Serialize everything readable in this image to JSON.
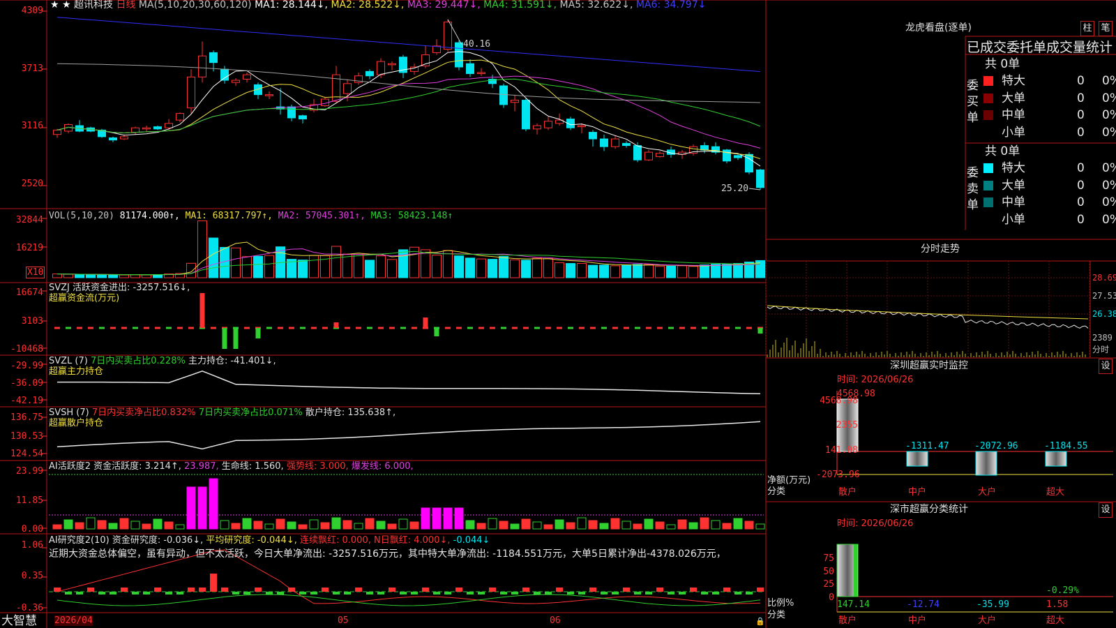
{
  "colors": {
    "up": "#ff3232",
    "down": "#00e5f0",
    "border": "#b81414",
    "ma1": "#ffffff",
    "ma2": "#f0e040",
    "ma3": "#e040e0",
    "ma4": "#30d030",
    "ma5": "#a0a0a0",
    "ma6": "#3030ff"
  },
  "main": {
    "star": "★ ★",
    "stock_name": "超讯科技",
    "period": "日线",
    "ma_list": "MA(5,10,20,30,60,120)",
    "ma1": "MA1: 28.144↓,",
    "ma2": "MA2: 28.522↓,",
    "ma3": "MA3: 29.447↓,",
    "ma4": "MA4: 31.591↓,",
    "ma5": "MA5: 32.622↓,",
    "ma6": "MA6: 34.797↓",
    "y_labels": [
      "4309",
      "3713",
      "3116",
      "2520"
    ],
    "high_label": "40.16",
    "low_label": "25.20"
  },
  "vol": {
    "title": "VOL(5,10,20)",
    "value": "81174.000↑,",
    "ma1": "MA1: 68317.797↑,",
    "ma2": "MA2: 57045.301↑,",
    "ma3": "MA3: 58423.148↑",
    "y_labels": [
      "32844",
      "16219"
    ],
    "unit": "X10"
  },
  "svzj": {
    "title": "SVZJ  活跃资金进出: -3257.516↓,",
    "subtitle": "超赢资金流(万元)",
    "y_labels": [
      "16674",
      "3103",
      "-10468"
    ]
  },
  "svzl": {
    "title": "SVZL (7)",
    "p1": "7日内买卖占比0.228%",
    "p2": "主力持仓: -41.401↓,",
    "subtitle": "超赢主力持仓",
    "y_labels": [
      "-29.99",
      "-36.09",
      "-42.19"
    ]
  },
  "svsh": {
    "title": "SVSH (7)",
    "p1": "7日内买卖净占比0.832%",
    "p2": "7日内买卖净占比0.071%",
    "p3": "散户持仓: 135.638↑,",
    "subtitle": "超赢散户持仓",
    "y_labels": [
      "136.75",
      "130.53",
      "124.54"
    ]
  },
  "ai2": {
    "title": "AI活跃度2 资金活跃度: 3.214↑,",
    "v1": "23.987,",
    "v2": "生命线: 1.560,",
    "v3": "强势线: 3.000,",
    "v4": "爆发线: 6.000,",
    "y_labels": [
      "23.99",
      "11.85",
      "0.00"
    ]
  },
  "ai10": {
    "title": "AI研究度2(10) 资金研究度: -0.036↓,",
    "v1": "平均研究度: -0.044↓,",
    "v2": "连续飘红: 0.000,",
    "v3": "N日飘红: 4.000↓,",
    "v4": "-0.044↓",
    "note": "近期大资金总体偏空，虽有异动，但不太活跃，今日大单净流出: -3257.516万元，其中特大单净流出: -1184.551万元，大单5日累计净出-4378.026万元，",
    "y_labels": [
      "1.06",
      "0.35",
      "-0.36"
    ]
  },
  "footer": {
    "brand": "大智慧",
    "dates": [
      "2026/04",
      "05",
      "06"
    ]
  },
  "right": {
    "lhb_title": "龙虎看盘(逐单)",
    "tab_zhu": "柱",
    "tab_bi": "笔",
    "stat_title": "已成交委托单成交量统计",
    "buy": {
      "side": "委买单",
      "total": "共 0单",
      "rows": [
        [
          "特大",
          "0",
          "0%"
        ],
        [
          "大单",
          "0",
          "0%"
        ],
        [
          "中单",
          "0",
          "0%"
        ],
        [
          "小单",
          "0",
          "0%"
        ]
      ]
    },
    "sell": {
      "side": "委卖单",
      "total": "共 0单",
      "rows": [
        [
          "特大",
          "0",
          "0%"
        ],
        [
          "大单",
          "0",
          "0%"
        ],
        [
          "中单",
          "0",
          "0%"
        ],
        [
          "小单",
          "0",
          "0%"
        ]
      ]
    },
    "fs_title": "分时走势",
    "fs_labels": [
      "28.69",
      "27.53",
      "26.38",
      "2389",
      "分时"
    ],
    "sz_title": "深圳超赢实时监控",
    "sz_set": "设",
    "sz_time": "时间: 2026/06/26",
    "sz_y": [
      "4568.98",
      "2355",
      "141.08",
      "-2073.96"
    ],
    "sz_axis": "净额(万元)",
    "sz_cat": "分类",
    "sz_cats": [
      "散户",
      "中户",
      "大户",
      "超大"
    ],
    "sz_values": [
      "4568.98",
      "-1311.47",
      "-2072.96",
      "-1184.55"
    ],
    "cls_title": "深市超赢分类统计",
    "cls_set": "设",
    "cls_time": "时间: 2026/06/26",
    "cls_y": [
      "75",
      "50",
      "25",
      "0"
    ],
    "cls_axis": "比例%",
    "cls_cat": "分类",
    "cls_values": [
      "147.14",
      "-12.74",
      "-35.99",
      "1.58"
    ],
    "cls_extra": "-0.29%",
    "cls_cats": [
      "散户",
      "中户",
      "大户",
      "超大"
    ]
  },
  "chart_data": {
    "type": "candlestick",
    "note_units": "price (CNY)",
    "candles": [
      [
        30.0,
        30.4,
        29.7,
        30.5
      ],
      [
        30.3,
        30.9,
        30.1,
        31.0
      ],
      [
        30.8,
        30.3,
        30.2,
        31.3
      ],
      [
        30.6,
        30.3,
        30.2,
        30.7
      ],
      [
        30.4,
        29.8,
        29.7,
        30.5
      ],
      [
        29.7,
        29.5,
        29.3,
        29.8
      ],
      [
        29.6,
        29.8,
        29.5,
        30.0
      ],
      [
        30.2,
        30.6,
        30.0,
        30.7
      ],
      [
        30.5,
        30.6,
        30.3,
        30.8
      ],
      [
        30.7,
        30.5,
        30.4,
        30.8
      ],
      [
        30.6,
        31.0,
        30.4,
        31.4
      ],
      [
        31.3,
        31.9,
        31.1,
        32.0
      ],
      [
        32.4,
        35.2,
        31.9,
        35.9
      ],
      [
        35.2,
        37.1,
        34.7,
        38.4
      ],
      [
        37.4,
        36.5,
        35.7,
        37.6
      ],
      [
        35.9,
        34.9,
        34.6,
        36.2
      ],
      [
        34.7,
        34.9,
        34.4,
        35.1
      ],
      [
        35.0,
        35.4,
        34.7,
        35.6
      ],
      [
        34.5,
        33.6,
        33.2,
        34.7
      ],
      [
        33.5,
        33.6,
        33.2,
        33.9
      ],
      [
        32.5,
        32.3,
        31.8,
        34.2
      ],
      [
        32.5,
        31.5,
        31.2,
        32.7
      ],
      [
        31.7,
        31.4,
        31.0,
        31.8
      ],
      [
        32.2,
        32.7,
        32.0,
        33.2
      ],
      [
        32.6,
        33.2,
        32.5,
        33.4
      ],
      [
        33.0,
        35.4,
        32.8,
        36.2
      ],
      [
        33.7,
        34.6,
        33.0,
        35.0
      ],
      [
        34.7,
        35.3,
        34.5,
        35.6
      ],
      [
        35.7,
        35.3,
        35.0,
        35.9
      ],
      [
        35.4,
        36.6,
        35.1,
        36.9
      ],
      [
        36.3,
        36.4,
        35.8,
        36.6
      ],
      [
        37.0,
        35.6,
        35.1,
        37.2
      ],
      [
        35.7,
        36.1,
        35.4,
        36.4
      ],
      [
        36.2,
        37.2,
        36.0,
        38.0
      ],
      [
        37.4,
        38.0,
        37.2,
        38.6
      ],
      [
        37.7,
        40.16,
        37.5,
        40.4
      ],
      [
        38.3,
        36.1,
        35.8,
        38.5
      ],
      [
        36.4,
        35.5,
        35.2,
        36.8
      ],
      [
        35.6,
        35.6,
        35.3,
        36.0
      ],
      [
        35.0,
        34.6,
        34.2,
        35.4
      ],
      [
        34.4,
        32.7,
        32.4,
        34.6
      ],
      [
        32.9,
        33.1,
        32.1,
        33.6
      ],
      [
        33.1,
        30.5,
        30.3,
        33.3
      ],
      [
        30.5,
        30.8,
        30.0,
        31.0
      ],
      [
        30.6,
        31.2,
        30.4,
        31.6
      ],
      [
        31.0,
        31.3,
        30.8,
        31.9
      ],
      [
        31.4,
        30.6,
        30.4,
        31.6
      ],
      [
        30.7,
        30.8,
        30.1,
        31.0
      ],
      [
        30.2,
        29.6,
        28.9,
        30.4
      ],
      [
        29.6,
        28.9,
        28.5,
        30.0
      ],
      [
        28.9,
        29.6,
        28.7,
        29.9
      ],
      [
        29.2,
        29.0,
        28.8,
        29.4
      ],
      [
        29.0,
        27.7,
        27.5,
        29.3
      ],
      [
        27.7,
        28.4,
        27.6,
        28.6
      ],
      [
        28.0,
        28.3,
        27.9,
        28.5
      ],
      [
        28.6,
        28.2,
        27.9,
        28.9
      ],
      [
        28.2,
        28.4,
        27.8,
        28.6
      ],
      [
        28.3,
        28.9,
        28.1,
        29.1
      ],
      [
        29.0,
        28.6,
        28.3,
        29.3
      ],
      [
        28.9,
        28.4,
        28.2,
        29.3
      ],
      [
        28.6,
        27.6,
        27.4,
        28.7
      ],
      [
        28.1,
        27.9,
        27.7,
        28.2
      ],
      [
        28.2,
        26.6,
        26.4,
        28.4
      ],
      [
        26.8,
        25.2,
        25.0,
        26.9
      ]
    ],
    "volume_x10": [
      2100,
      1900,
      1800,
      1700,
      1600,
      1500,
      1550,
      1700,
      1650,
      1750,
      2100,
      2300,
      8000,
      31500,
      22000,
      16800,
      16500,
      11700,
      11900,
      12300,
      17100,
      10200,
      9800,
      12400,
      12200,
      17400,
      13100,
      13000,
      9700,
      12100,
      10100,
      15500,
      16900,
      15500,
      12500,
      15100,
      12100,
      10900,
      10400,
      10200,
      11800,
      9900,
      9700,
      10800,
      10600,
      8300,
      7900,
      7900,
      6900,
      7000,
      6600,
      7100,
      7400,
      7300,
      6300,
      6400,
      6600,
      6300,
      7100,
      7500,
      7700,
      7900,
      8700,
      9500
    ]
  }
}
